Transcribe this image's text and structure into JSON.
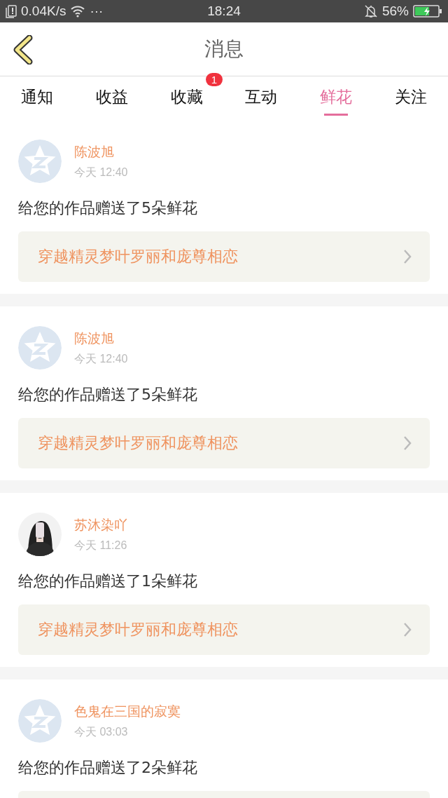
{
  "status_bar": {
    "speed": "0.04K/s",
    "dots": "···",
    "time": "18:24",
    "battery": "56%"
  },
  "header": {
    "title": "消息"
  },
  "tabs": [
    {
      "label": "通知",
      "selected": false
    },
    {
      "label": "收益",
      "selected": false
    },
    {
      "label": "收藏",
      "selected": false,
      "badge": "1"
    },
    {
      "label": "互动",
      "selected": false
    },
    {
      "label": "鲜花",
      "selected": true
    },
    {
      "label": "关注",
      "selected": false
    }
  ],
  "messages": [
    {
      "kind": "default",
      "name": "陈波旭",
      "time": "今天 12:40",
      "text": "给您的作品赠送了5朵鲜花",
      "work": "穿越精灵梦叶罗丽和庞尊相恋"
    },
    {
      "kind": "default",
      "name": "陈波旭",
      "time": "今天 12:40",
      "text": "给您的作品赠送了5朵鲜花",
      "work": "穿越精灵梦叶罗丽和庞尊相恋"
    },
    {
      "kind": "picture",
      "name": "苏沐染吖",
      "time": "今天 11:26",
      "text": "给您的作品赠送了1朵鲜花",
      "work": "穿越精灵梦叶罗丽和庞尊相恋"
    },
    {
      "kind": "default",
      "name": "色鬼在三国的寂寞",
      "time": "今天 03:03",
      "text": "给您的作品赠送了2朵鲜花"
    }
  ]
}
